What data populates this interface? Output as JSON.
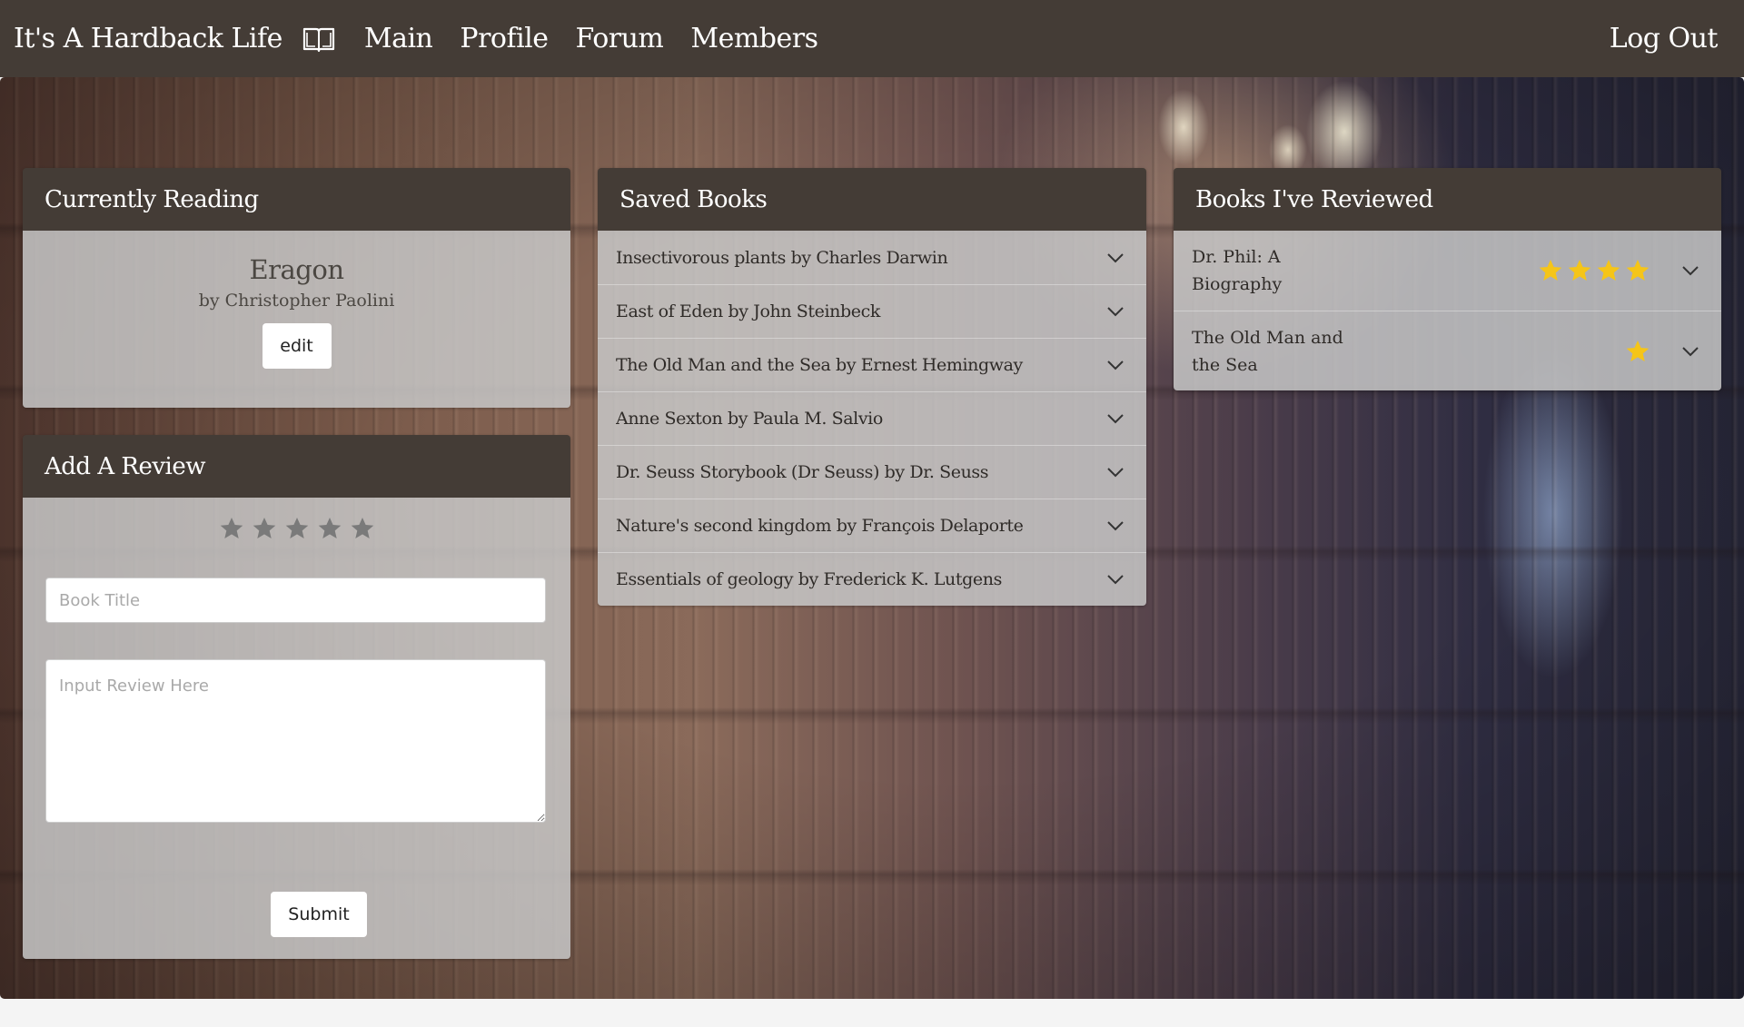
{
  "nav": {
    "brand": "It's A Hardback Life",
    "brand_icon": "open-book-icon",
    "links": [
      "Main",
      "Profile",
      "Forum",
      "Members"
    ],
    "logout": "Log Out"
  },
  "currently_reading": {
    "header": "Currently Reading",
    "title": "Eragon",
    "author": "by Christopher Paolini",
    "edit_label": "edit"
  },
  "add_review": {
    "header": "Add A Review",
    "rating_stars": 5,
    "rating_value": 0,
    "title_placeholder": "Book Title",
    "review_placeholder": "Input Review Here",
    "submit_label": "Submit"
  },
  "saved_books": {
    "header": "Saved Books",
    "items": [
      "Insectivorous plants by Charles Darwin",
      "East of Eden by John Steinbeck",
      "The Old Man and the Sea by Ernest Hemingway",
      "Anne Sexton by Paula M. Salvio",
      "Dr. Seuss Storybook (Dr Seuss) by Dr. Seuss",
      "Nature's second kingdom by François Delaporte",
      "Essentials of geology by Frederick K. Lutgens"
    ]
  },
  "reviewed_books": {
    "header": "Books I've Reviewed",
    "items": [
      {
        "title_line1": "Dr. Phil: A",
        "title_line2": "Biography",
        "stars": 4
      },
      {
        "title_line1": "The Old Man and",
        "title_line2": "the Sea",
        "stars": 1
      }
    ]
  },
  "colors": {
    "nav_bg": "#443c36",
    "card_body": "#c6c6c6",
    "star_gold": "#f5c518",
    "star_empty": "#7a7a7a"
  }
}
